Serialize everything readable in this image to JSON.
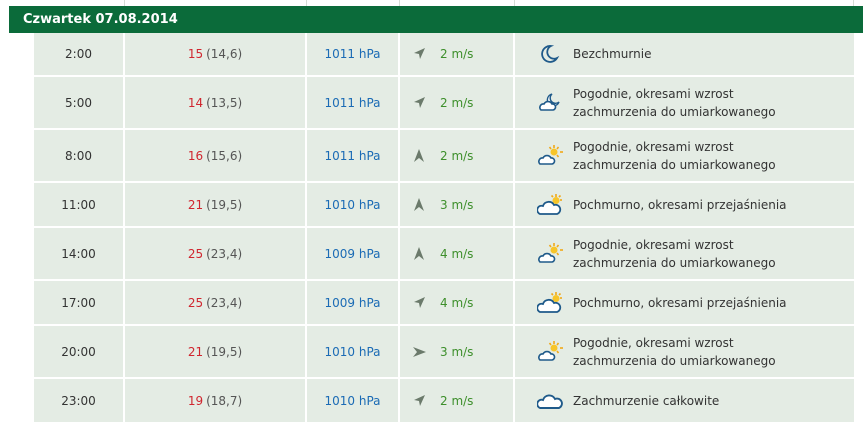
{
  "header": {
    "title": "Czwartek 07.08.2014"
  },
  "colors": {
    "header_bg": "#0b6b3a",
    "row_bg": "#e4ece4",
    "temp": "#d0262f",
    "pressure": "#1b6bb5",
    "wind": "#3d8f2b",
    "icon": "#1f5a8a"
  },
  "rows": [
    {
      "time": "2:00",
      "temp": "15",
      "feel": "(14,6)",
      "pressure": "1011 hPa",
      "wind": "2 m/s",
      "wind_dir_icon": "arrow-northeast-icon",
      "weather_icon": "moon-icon",
      "desc_line1": "Bezchmurnie",
      "desc_line2": ""
    },
    {
      "time": "5:00",
      "temp": "14",
      "feel": "(13,5)",
      "pressure": "1011 hPa",
      "wind": "2 m/s",
      "wind_dir_icon": "arrow-northeast-icon",
      "weather_icon": "moon-cloud-icon",
      "desc_line1": "Pogodnie, okresami wzrost",
      "desc_line2": "zachmurzenia do umiarkowanego"
    },
    {
      "time": "8:00",
      "temp": "16",
      "feel": "(15,6)",
      "pressure": "1011 hPa",
      "wind": "2 m/s",
      "wind_dir_icon": "arrow-north-icon",
      "weather_icon": "sun-cloud-icon",
      "desc_line1": "Pogodnie, okresami wzrost",
      "desc_line2": "zachmurzenia do umiarkowanego"
    },
    {
      "time": "11:00",
      "temp": "21",
      "feel": "(19,5)",
      "pressure": "1010 hPa",
      "wind": "3 m/s",
      "wind_dir_icon": "arrow-north-icon",
      "weather_icon": "cloud-sun-icon",
      "desc_line1": "Pochmurno, okresami przejaśnienia",
      "desc_line2": ""
    },
    {
      "time": "14:00",
      "temp": "25",
      "feel": "(23,4)",
      "pressure": "1009 hPa",
      "wind": "4 m/s",
      "wind_dir_icon": "arrow-north-icon",
      "weather_icon": "sun-cloud-icon",
      "desc_line1": "Pogodnie, okresami wzrost",
      "desc_line2": "zachmurzenia do umiarkowanego"
    },
    {
      "time": "17:00",
      "temp": "25",
      "feel": "(23,4)",
      "pressure": "1009 hPa",
      "wind": "4 m/s",
      "wind_dir_icon": "arrow-northeast-icon",
      "weather_icon": "cloud-sun-icon",
      "desc_line1": "Pochmurno, okresami przejaśnienia",
      "desc_line2": ""
    },
    {
      "time": "20:00",
      "temp": "21",
      "feel": "(19,5)",
      "pressure": "1010 hPa",
      "wind": "3 m/s",
      "wind_dir_icon": "arrow-east-icon",
      "weather_icon": "sun-cloud-icon",
      "desc_line1": "Pogodnie, okresami wzrost",
      "desc_line2": "zachmurzenia do umiarkowanego"
    },
    {
      "time": "23:00",
      "temp": "19",
      "feel": "(18,7)",
      "pressure": "1010 hPa",
      "wind": "2 m/s",
      "wind_dir_icon": "arrow-northeast-icon",
      "weather_icon": "cloud-icon",
      "desc_line1": "Zachmurzenie całkowite",
      "desc_line2": ""
    }
  ]
}
